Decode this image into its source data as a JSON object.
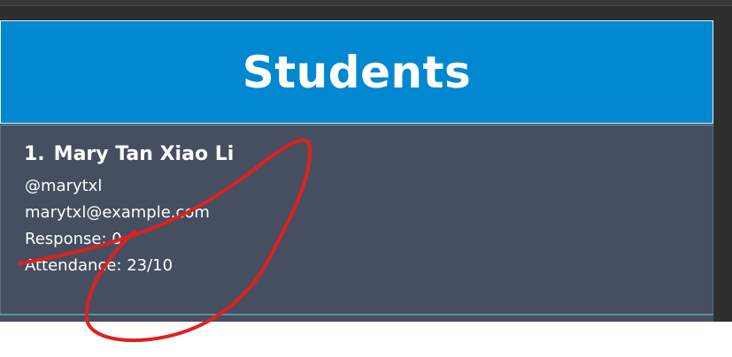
{
  "header": {
    "title": "Students"
  },
  "students": [
    {
      "index": "1.",
      "name": "Mary Tan Xiao Li",
      "handle": "@marytxl",
      "email": "marytxl@example.com",
      "response": "Response: 0",
      "attendance": "Attendance: 23/10"
    }
  ],
  "colors": {
    "header_bg": "#0288d1",
    "card_bg": "#454f60",
    "frame_bg": "#2e2e2e",
    "annotation_stroke": "#e0201e"
  }
}
